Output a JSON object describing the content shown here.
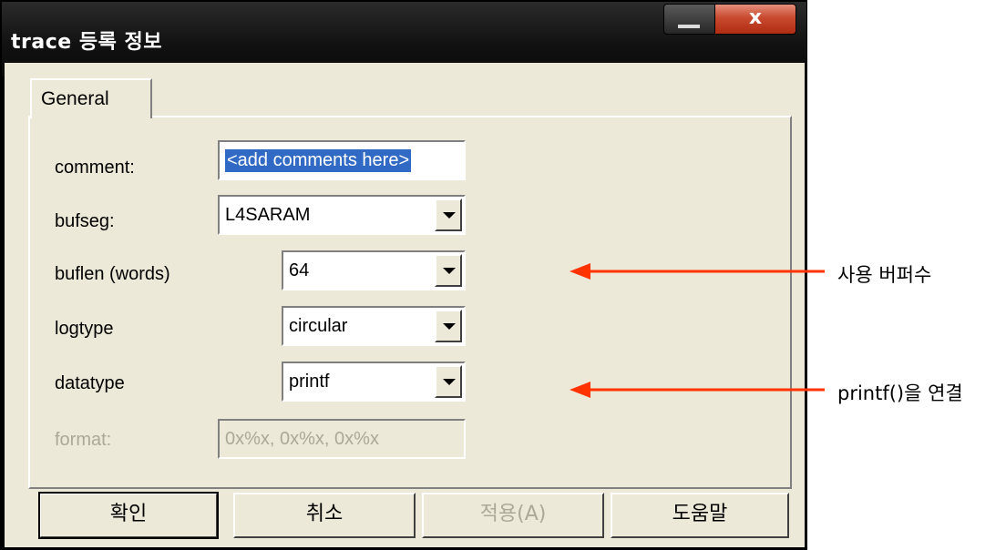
{
  "window": {
    "title": "trace 등록 정보",
    "close_glyph": "x"
  },
  "tab": {
    "label": "General"
  },
  "fields": {
    "comment": {
      "label": "comment:",
      "value": "<add comments here>"
    },
    "bufseg": {
      "label": "bufseg:",
      "value": "L4SARAM"
    },
    "buflen": {
      "label": "buflen (words)",
      "value": "64"
    },
    "logtype": {
      "label": "logtype",
      "value": "circular"
    },
    "datatype": {
      "label": "datatype",
      "value": "printf"
    },
    "format": {
      "label": "format:",
      "value": "0x%x, 0x%x, 0x%x"
    }
  },
  "buttons": {
    "ok": "확인",
    "cancel": "취소",
    "apply": "적용(A)",
    "help": "도움말"
  },
  "annotations": {
    "buflen_note": "사용 버퍼수",
    "datatype_note": "printf()을 연결",
    "arrow_color": "#ff3300"
  }
}
